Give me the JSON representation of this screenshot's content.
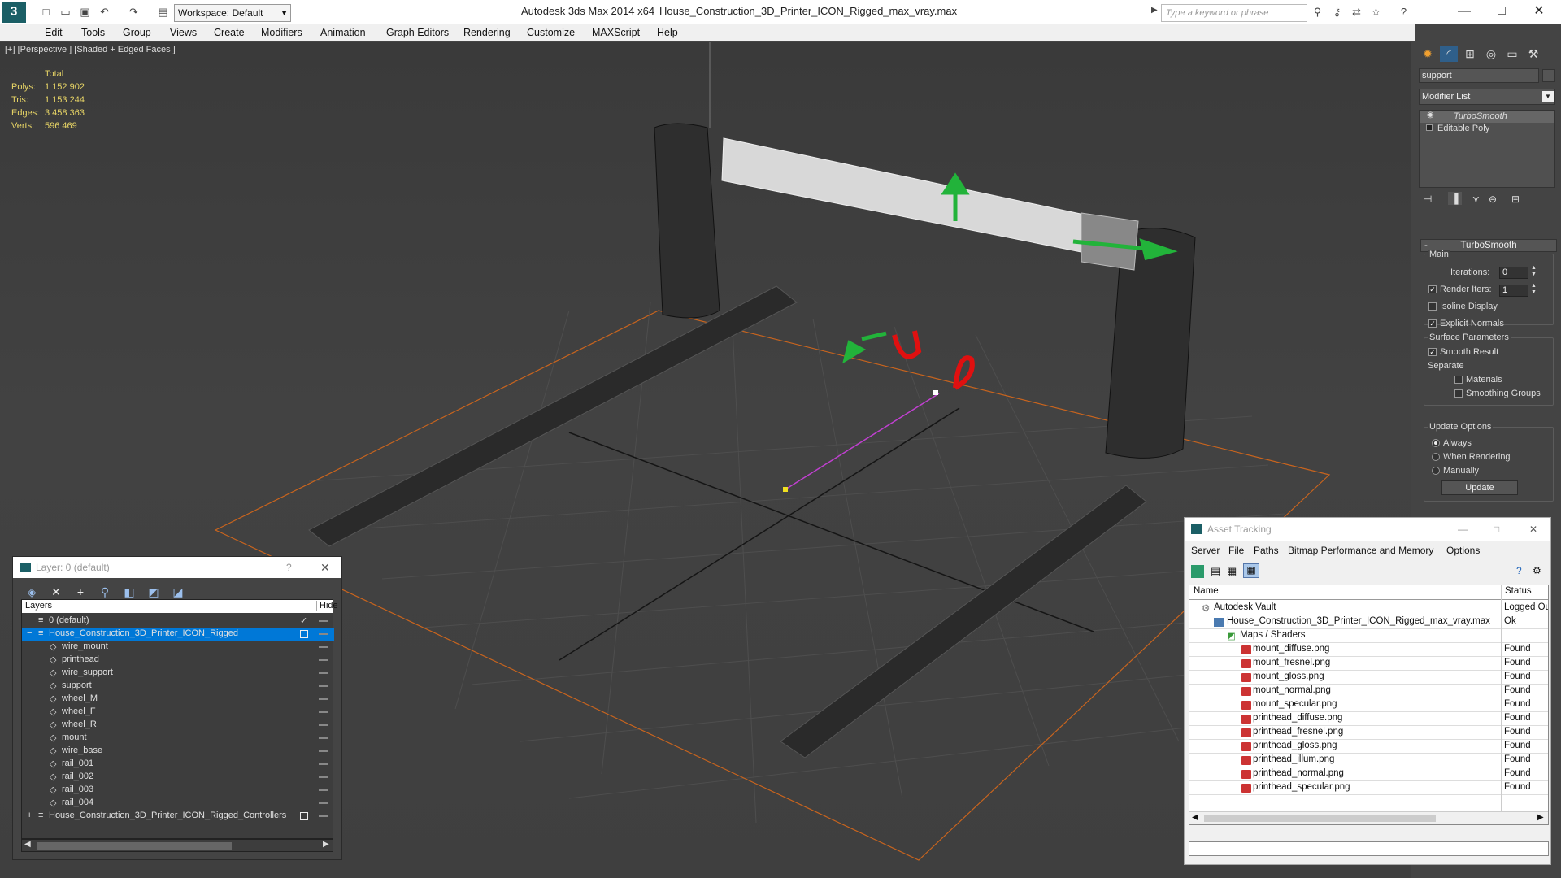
{
  "titlebar": {
    "app_title": "Autodesk 3ds Max  2014 x64",
    "file_title": "House_Construction_3D_Printer_ICON_Rigged_max_vray.max",
    "workspace": "Workspace: Default",
    "search_placeholder": "Type a keyword or phrase"
  },
  "menu": [
    "Edit",
    "Tools",
    "Group",
    "Views",
    "Create",
    "Modifiers",
    "Animation",
    "Graph Editors",
    "Rendering",
    "Customize",
    "MAXScript",
    "Help"
  ],
  "viewport": {
    "label": "[+] [Perspective ] [Shaded + Edged Faces ]",
    "stats": {
      "header": "Total",
      "rows": [
        {
          "label": "Polys:",
          "value": "1 152 902"
        },
        {
          "label": "Tris:",
          "value": "1 153 244"
        },
        {
          "label": "Edges:",
          "value": "3 458 363"
        },
        {
          "label": "Verts:",
          "value": "596 469"
        }
      ]
    }
  },
  "command_panel": {
    "object_name": "support",
    "modifier_list": "Modifier List",
    "stack": [
      "TurboSmooth",
      "Editable Poly"
    ],
    "rollout_title": "TurboSmooth",
    "main_label": "Main",
    "iterations_label": "Iterations:",
    "iterations_value": "0",
    "render_iters_label": "Render Iters:",
    "render_iters_value": "1",
    "isoline_label": "Isoline Display",
    "explicit_normals_label": "Explicit Normals",
    "surface_params_label": "Surface Parameters",
    "smooth_result_label": "Smooth Result",
    "separate_label": "Separate",
    "materials_label": "Materials",
    "smoothing_groups_label": "Smoothing Groups",
    "update_options_label": "Update Options",
    "always_label": "Always",
    "when_rendering_label": "When Rendering",
    "manually_label": "Manually",
    "update_button": "Update"
  },
  "layer_window": {
    "title": "Layer: 0 (default)",
    "help_glyph": "?",
    "col_layers": "Layers",
    "col_hide": "Hide",
    "rows": [
      "0 (default)",
      "House_Construction_3D_Printer_ICON_Rigged",
      "wire_mount",
      "printhead",
      "wire_support",
      "support",
      "wheel_M",
      "wheel_F",
      "wheel_R",
      "mount",
      "wire_base",
      "rail_001",
      "rail_002",
      "rail_003",
      "rail_004",
      "House_Construction_3D_Printer_ICON_Rigged_Controllers"
    ]
  },
  "asset_window": {
    "title": "Asset Tracking",
    "menu": [
      "Server",
      "File",
      "Paths",
      "Bitmap Performance and Memory",
      "Options"
    ],
    "col_name": "Name",
    "col_status": "Status",
    "rows": [
      {
        "name": "Autodesk Vault",
        "status": "Logged Ou"
      },
      {
        "name": "House_Construction_3D_Printer_ICON_Rigged_max_vray.max",
        "status": "Ok"
      },
      {
        "name": "Maps / Shaders",
        "status": ""
      },
      {
        "name": "mount_diffuse.png",
        "status": "Found"
      },
      {
        "name": "mount_fresnel.png",
        "status": "Found"
      },
      {
        "name": "mount_gloss.png",
        "status": "Found"
      },
      {
        "name": "mount_normal.png",
        "status": "Found"
      },
      {
        "name": "mount_specular.png",
        "status": "Found"
      },
      {
        "name": "printhead_diffuse.png",
        "status": "Found"
      },
      {
        "name": "printhead_fresnel.png",
        "status": "Found"
      },
      {
        "name": "printhead_gloss.png",
        "status": "Found"
      },
      {
        "name": "printhead_illum.png",
        "status": "Found"
      },
      {
        "name": "printhead_normal.png",
        "status": "Found"
      },
      {
        "name": "printhead_specular.png",
        "status": "Found"
      }
    ]
  },
  "colors": {
    "accent": "#0078d7",
    "stats": "#e8d566",
    "gizmo_green": "#22b33a",
    "gizmo_red": "#e01010",
    "bounds_orange": "#c8641e"
  }
}
